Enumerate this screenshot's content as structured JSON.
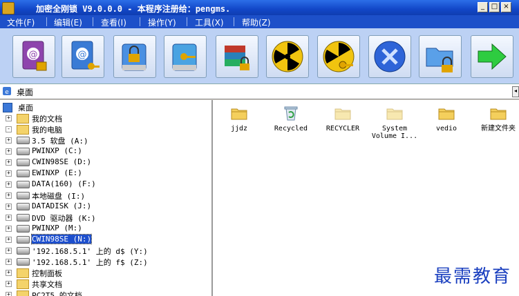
{
  "window": {
    "title": "加密全刚锁  V9.0.0.0 - 本程序注册给：pengms."
  },
  "menu": [
    "文件(F)",
    "编辑(E)",
    "查看(I)",
    "操作(Y)",
    "工具(X)",
    "帮助(Z)"
  ],
  "toolbar_icons": [
    "encrypt-book-icon",
    "decrypt-book-icon",
    "lock-drive-icon",
    "unlock-drive-icon",
    "archive-lock-icon",
    "radiation-icon",
    "radiation-key-icon",
    "disable-icon",
    "folder-lock-icon",
    "exit-arrow-icon"
  ],
  "address": "桌面",
  "tree": [
    {
      "label": "桌面",
      "level": 0,
      "exp": ""
    },
    {
      "label": "我的文档",
      "level": 1,
      "exp": "+"
    },
    {
      "label": "我的电脑",
      "level": 1,
      "exp": "-"
    },
    {
      "label": "3.5 软盘 (A:)",
      "level": 2,
      "exp": "+"
    },
    {
      "label": "PWINXP (C:)",
      "level": 2,
      "exp": "+"
    },
    {
      "label": "CWIN98SE (D:)",
      "level": 2,
      "exp": "+"
    },
    {
      "label": "EWINXP (E:)",
      "level": 2,
      "exp": "+"
    },
    {
      "label": "DATA(160) (F:)",
      "level": 2,
      "exp": "+"
    },
    {
      "label": "本地磁盘 (I:)",
      "level": 2,
      "exp": "+"
    },
    {
      "label": "DATADISK (J:)",
      "level": 2,
      "exp": "+"
    },
    {
      "label": "DVD 驱动器 (K:)",
      "level": 2,
      "exp": "+"
    },
    {
      "label": "PWINXP (M:)",
      "level": 2,
      "exp": "+"
    },
    {
      "label": "CWIN98SE (N:)",
      "level": 2,
      "exp": "+",
      "selected": true
    },
    {
      "label": "'192.168.5.1' 上的 d$ (Y:)",
      "level": 2,
      "exp": "+"
    },
    {
      "label": "'192.168.5.1' 上的 f$ (Z:)",
      "level": 2,
      "exp": "+"
    },
    {
      "label": "控制面板",
      "level": 2,
      "exp": "+"
    },
    {
      "label": "共享文档",
      "level": 2,
      "exp": "+"
    },
    {
      "label": "PC2T5 的文档",
      "level": 2,
      "exp": "+"
    }
  ],
  "files": [
    {
      "label": "jjdz",
      "icon": "folder-icon"
    },
    {
      "label": "Recycled",
      "icon": "recycle-bin-icon"
    },
    {
      "label": "RECYCLER",
      "icon": "folder-icon"
    },
    {
      "label": "System\nVolume I...",
      "icon": "folder-icon"
    },
    {
      "label": "vedio",
      "icon": "folder-icon"
    },
    {
      "label": "新建文件夹",
      "icon": "folder-icon"
    }
  ],
  "watermark": "最需教育"
}
